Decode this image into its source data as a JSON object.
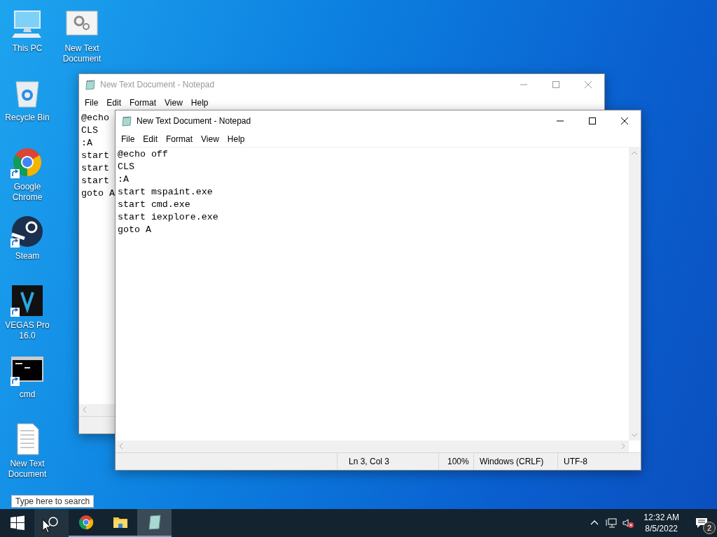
{
  "desktop_icons": [
    {
      "label": "This PC",
      "kind": "pc",
      "shortcut": false
    },
    {
      "label": "Recycle Bin",
      "kind": "recycle",
      "shortcut": false
    },
    {
      "label": "Google Chrome",
      "kind": "chrome",
      "shortcut": true
    },
    {
      "label": "Steam",
      "kind": "steam",
      "shortcut": true
    },
    {
      "label": "VEGAS Pro 16.0",
      "kind": "vegas",
      "shortcut": true
    },
    {
      "label": "cmd",
      "kind": "cmd",
      "shortcut": true
    },
    {
      "label": "New Text Document",
      "kind": "textfile",
      "shortcut": false
    },
    {
      "label": "New Text Document",
      "kind": "settingsfile",
      "shortcut": false
    }
  ],
  "windows": [
    {
      "title": "New Text Document - Notepad",
      "active": false,
      "menu": [
        "File",
        "Edit",
        "Format",
        "View",
        "Help"
      ],
      "lines": [
        "@echo",
        "CLS",
        ":A",
        "start",
        "start",
        "start",
        "goto A"
      ]
    },
    {
      "title": "New Text Document - Notepad",
      "active": true,
      "menu": [
        "File",
        "Edit",
        "Format",
        "View",
        "Help"
      ],
      "lines": [
        "@echo off",
        "CLS",
        ":A",
        "start mspaint.exe",
        "start cmd.exe",
        "start iexplore.exe",
        "goto A"
      ],
      "status": [
        "Ln 3, Col 3",
        "100%",
        "Windows (CRLF)",
        "UTF-8"
      ]
    }
  ],
  "taskbar": {
    "tooltip": "Type here to search",
    "items": [
      {
        "kind": "start",
        "running": false,
        "active": false,
        "hovered": false
      },
      {
        "kind": "search",
        "running": false,
        "active": false,
        "hovered": true
      },
      {
        "kind": "chrome",
        "running": true,
        "active": false,
        "hovered": false
      },
      {
        "kind": "explorer",
        "running": true,
        "active": false,
        "hovered": false
      },
      {
        "kind": "notepad",
        "running": true,
        "active": true,
        "hovered": false
      }
    ],
    "tray": {
      "volume_muted": true,
      "time": "12:32 AM",
      "date": "8/5/2022",
      "notifications": "2"
    }
  }
}
